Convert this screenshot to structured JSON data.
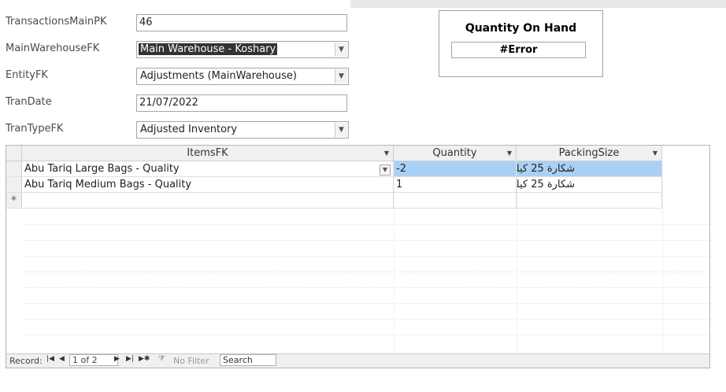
{
  "form": {
    "fields": [
      {
        "label": "TransactionsMainPK",
        "value": "46"
      },
      {
        "label": "MainWarehouseFK",
        "value": "Main Warehouse - Koshary"
      },
      {
        "label": "EntityFK",
        "value": "Adjustments (MainWarehouse)"
      },
      {
        "label": "TranDate",
        "value": "21/07/2022"
      },
      {
        "label": "TranTypeFK",
        "value": "Adjusted Inventory"
      }
    ]
  },
  "qoh": {
    "title": "Quantity On Hand",
    "value": "#Error"
  },
  "datasheet": {
    "columns": [
      "ItemsFK",
      "Quantity",
      "PackingSize"
    ],
    "rows": [
      {
        "item": "Abu Tariq Large Bags - Quality",
        "quantity": "-2",
        "packing": "شكارة 25 كيلو"
      },
      {
        "item": "Abu Tariq Medium Bags - Quality",
        "quantity": "1",
        "packing": "شكارة 25 كيلو"
      }
    ],
    "new_row_marker": "*"
  },
  "navbar": {
    "record_label": "Record:",
    "record_position": "1 of 2",
    "no_filter": "No Filter",
    "search": "Search"
  },
  "colors": {
    "selected_cell": "#a9d0f5",
    "selected_combo_text_bg": "#333333"
  }
}
